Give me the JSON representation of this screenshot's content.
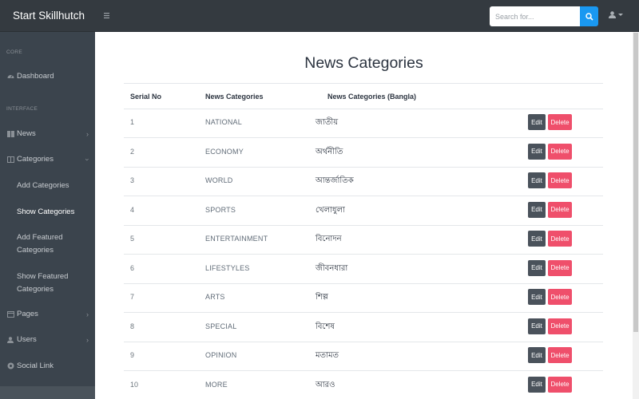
{
  "app": {
    "brand": "Start Skillhutch"
  },
  "search": {
    "placeholder": "Search for..."
  },
  "sidebar": {
    "core_heading": "CORE",
    "dashboard": "Dashboard",
    "interface_heading": "INTERFACE",
    "news": "News",
    "categories": "Categories",
    "add_categories": "Add Categories",
    "show_categories": "Show Categories",
    "add_featured_1": "Add Featured",
    "add_featured_2": "Categories",
    "show_featured_1": "Show Featured",
    "show_featured_2": "Categories",
    "pages": "Pages",
    "users": "Users",
    "social_link": "Social Link"
  },
  "main": {
    "title": "News Categories",
    "headers": {
      "serial": "Serial No",
      "category": "News Categories",
      "bangla": "News Categories (Bangla)"
    },
    "edit_label": "Edit",
    "delete_label": "Delete",
    "rows": [
      {
        "serial": "1",
        "category": "NATIONAL",
        "bangla": "জাতীয়"
      },
      {
        "serial": "2",
        "category": "ECONOMY",
        "bangla": "অর্থনীতি"
      },
      {
        "serial": "3",
        "category": "WORLD",
        "bangla": "আন্তর্জাতিক"
      },
      {
        "serial": "4",
        "category": "SPORTS",
        "bangla": "খেলাধুলা"
      },
      {
        "serial": "5",
        "category": "ENTERTAINMENT",
        "bangla": "বিনোদন"
      },
      {
        "serial": "6",
        "category": "LIFESTYLES",
        "bangla": "জীবনধারা"
      },
      {
        "serial": "7",
        "category": "ARTS",
        "bangla": "শিল্প"
      },
      {
        "serial": "8",
        "category": "SPECIAL",
        "bangla": "বিশেষ"
      },
      {
        "serial": "9",
        "category": "OPINION",
        "bangla": "মতামত"
      },
      {
        "serial": "10",
        "category": "MORE",
        "bangla": "আরও"
      }
    ]
  },
  "colors": {
    "topbar": "#343a40",
    "sidebar": "#3b444d",
    "search_button": "#1a98f1",
    "edit": "#4a525b",
    "delete": "#ef4f6b"
  },
  "icons": [
    "menu-icon",
    "search-icon",
    "user-icon",
    "caret-down-icon",
    "tachometer-icon",
    "columns-icon",
    "book-icon",
    "folder-icon",
    "user-icon",
    "link-icon",
    "chevron-right-icon",
    "chevron-down-icon"
  ]
}
